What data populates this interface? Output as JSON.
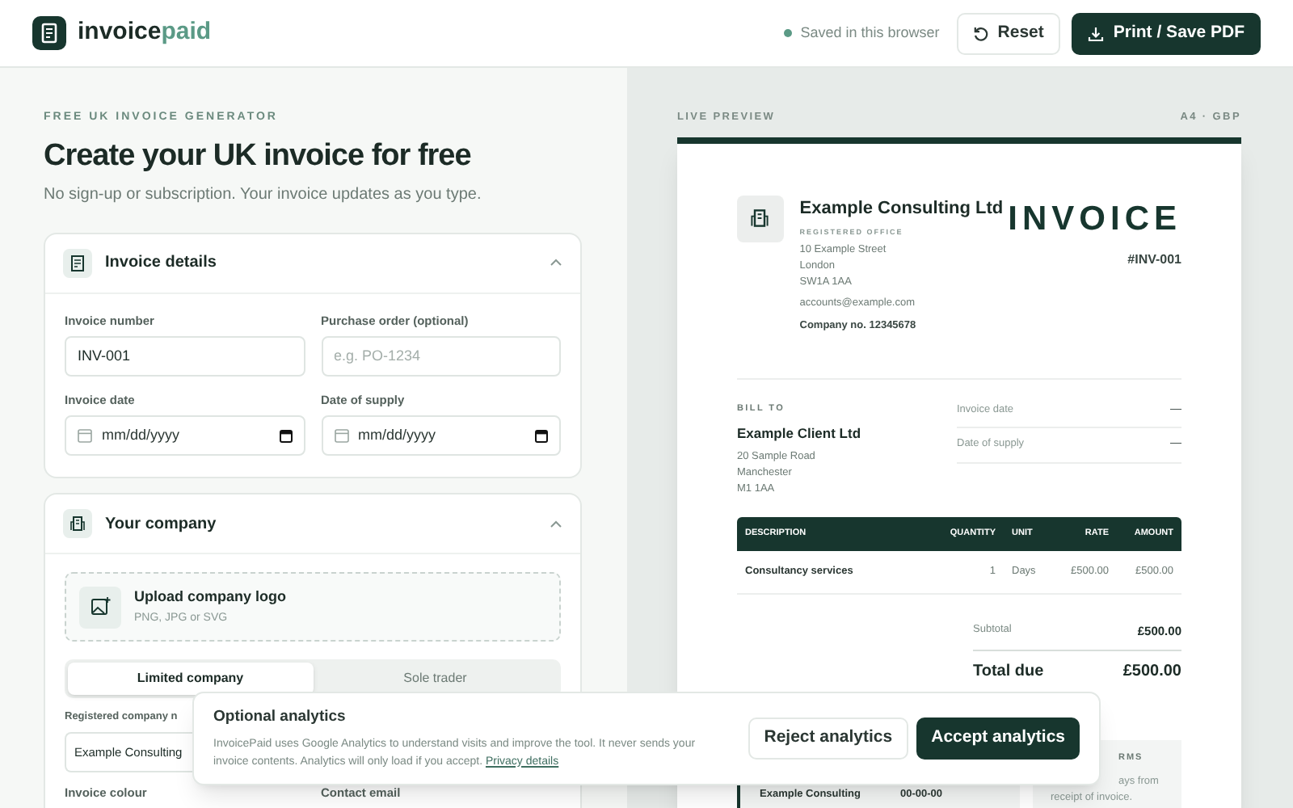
{
  "header": {
    "logo": {
      "main": "invoice",
      "accent": "paid"
    },
    "saved_status": "Saved in this browser",
    "buttons": [
      {
        "kind": "secondary",
        "label": "Reset"
      },
      {
        "kind": "primary",
        "label": "Print / Save PDF"
      }
    ]
  },
  "intro": {
    "eyebrow": "FREE UK INVOICE GENERATOR",
    "title": "Create your UK invoice for free",
    "subtitle": "No sign-up or subscription. Your invoice updates as you type."
  },
  "invoice_details": {
    "title": "Invoice details",
    "expanded": true,
    "fields": [
      {
        "kind": "text",
        "label": "Invoice number",
        "value": "INV-001"
      },
      {
        "kind": "text",
        "label": "Purchase order (optional)",
        "placeholder": "e.g. PO-1234"
      },
      {
        "kind": "date",
        "label": "Invoice date",
        "placeholder": "mm/dd/yyyy"
      },
      {
        "kind": "date",
        "label": "Date of supply",
        "placeholder": "mm/dd/yyyy"
      }
    ]
  },
  "your_company": {
    "title": "Your company",
    "expanded": true,
    "upload": {
      "title": "Upload company logo",
      "hint": "PNG, JPG or SVG"
    },
    "company_type": [
      {
        "label": "Limited company",
        "selected": true
      },
      {
        "label": "Sole trader",
        "selected": false
      }
    ],
    "registered_name_label": "Registered company n",
    "registered_name_value": "Example Consulting",
    "colour_label": "Invoice colour",
    "email_label": "Contact email"
  },
  "preview": {
    "label": "LIVE PREVIEW",
    "format": "A4 · GBP",
    "invoice": {
      "company_name": "Example Consulting Ltd",
      "office_label": "REGISTERED OFFICE",
      "address": [
        "10 Example Street",
        "London",
        "SW1A 1AA"
      ],
      "email": "accounts@example.com",
      "company_no": "Company no. 12345678",
      "title": "INVOICE",
      "number": "#INV-001",
      "bill_to_label": "BILL TO",
      "client_name": "Example Client Ltd",
      "client_address": [
        "20 Sample Road",
        "Manchester",
        "M1 1AA"
      ],
      "dates": [
        {
          "label": "Invoice date",
          "value": "—"
        },
        {
          "label": "Date of supply",
          "value": "—"
        }
      ],
      "columns": [
        "DESCRIPTION",
        "QUANTITY",
        "UNIT",
        "RATE",
        "AMOUNT"
      ],
      "rows": [
        [
          "Consultancy services",
          "1",
          "Days",
          "£500.00",
          "£500.00"
        ]
      ],
      "subtotal": {
        "label": "Subtotal",
        "value": "£500.00"
      },
      "total": {
        "label": "Total due",
        "value": "£500.00"
      },
      "payment": [
        "Example Consulting",
        "00-00-00"
      ],
      "terms": [
        "RMS",
        "ays from",
        "receipt of invoice."
      ]
    }
  },
  "analytics_banner": {
    "title": "Optional analytics",
    "text": "InvoicePaid uses Google Analytics to understand visits and improve the tool. It never sends your invoice contents. Analytics will only load if you accept.",
    "link": "Privacy details",
    "buttons": [
      {
        "kind": "secondary",
        "label": "Reject analytics"
      },
      {
        "kind": "primary",
        "label": "Accept analytics"
      }
    ]
  }
}
